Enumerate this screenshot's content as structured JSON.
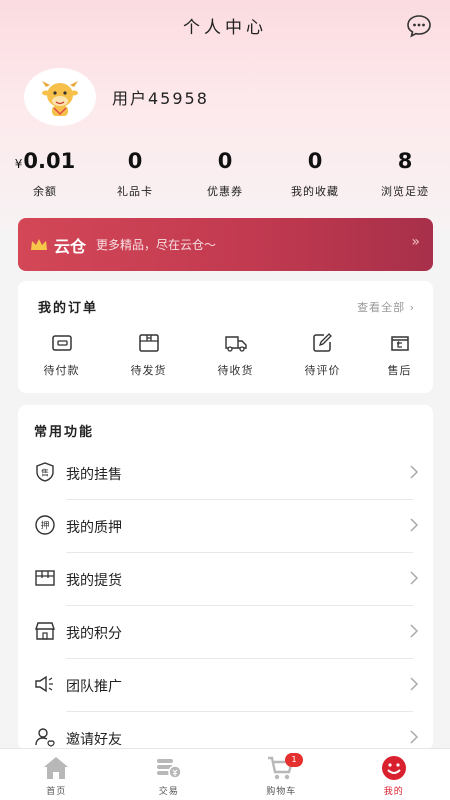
{
  "header": {
    "title": "个人中心",
    "chat_icon": "chat-bubble-icon"
  },
  "profile": {
    "username": "用户45958",
    "avatar_icon": "cow-mascot-icon"
  },
  "stats": [
    {
      "currency": "¥",
      "value": "0.01",
      "label": "余额"
    },
    {
      "value": "0",
      "label": "礼品卡"
    },
    {
      "value": "0",
      "label": "优惠券"
    },
    {
      "value": "0",
      "label": "我的收藏"
    },
    {
      "value": "8",
      "label": "浏览足迹"
    }
  ],
  "cloud": {
    "name": "云仓",
    "desc": "更多精品，尽在云仓～",
    "icon": "crown-icon",
    "arrow": "»"
  },
  "orders": {
    "title": "我的订单",
    "view_all": "查看全部",
    "items": [
      {
        "label": "待付款",
        "icon": "wallet-icon"
      },
      {
        "label": "待发货",
        "icon": "box-icon"
      },
      {
        "label": "待收货",
        "icon": "truck-icon"
      },
      {
        "label": "待评价",
        "icon": "edit-icon"
      },
      {
        "label": "售后",
        "icon": "return-icon"
      }
    ]
  },
  "functions": {
    "title": "常用功能",
    "items": [
      {
        "label": "我的挂售",
        "icon": "sale-shield-icon",
        "icon_text": "售"
      },
      {
        "label": "我的质押",
        "icon": "pledge-icon",
        "icon_text": "押"
      },
      {
        "label": "我的提货",
        "icon": "package-icon"
      },
      {
        "label": "我的积分",
        "icon": "shop-icon"
      },
      {
        "label": "团队推广",
        "icon": "megaphone-icon"
      },
      {
        "label": "邀请好友",
        "icon": "invite-user-icon"
      }
    ]
  },
  "tabbar": {
    "items": [
      {
        "label": "首页",
        "icon": "home-icon"
      },
      {
        "label": "交易",
        "icon": "trade-coins-icon"
      },
      {
        "label": "购物车",
        "icon": "cart-icon",
        "badge": "1"
      },
      {
        "label": "我的",
        "icon": "smile-profile-icon",
        "active": true
      }
    ]
  },
  "colors": {
    "accent": "#d9202f",
    "banner": "#c23a50"
  }
}
